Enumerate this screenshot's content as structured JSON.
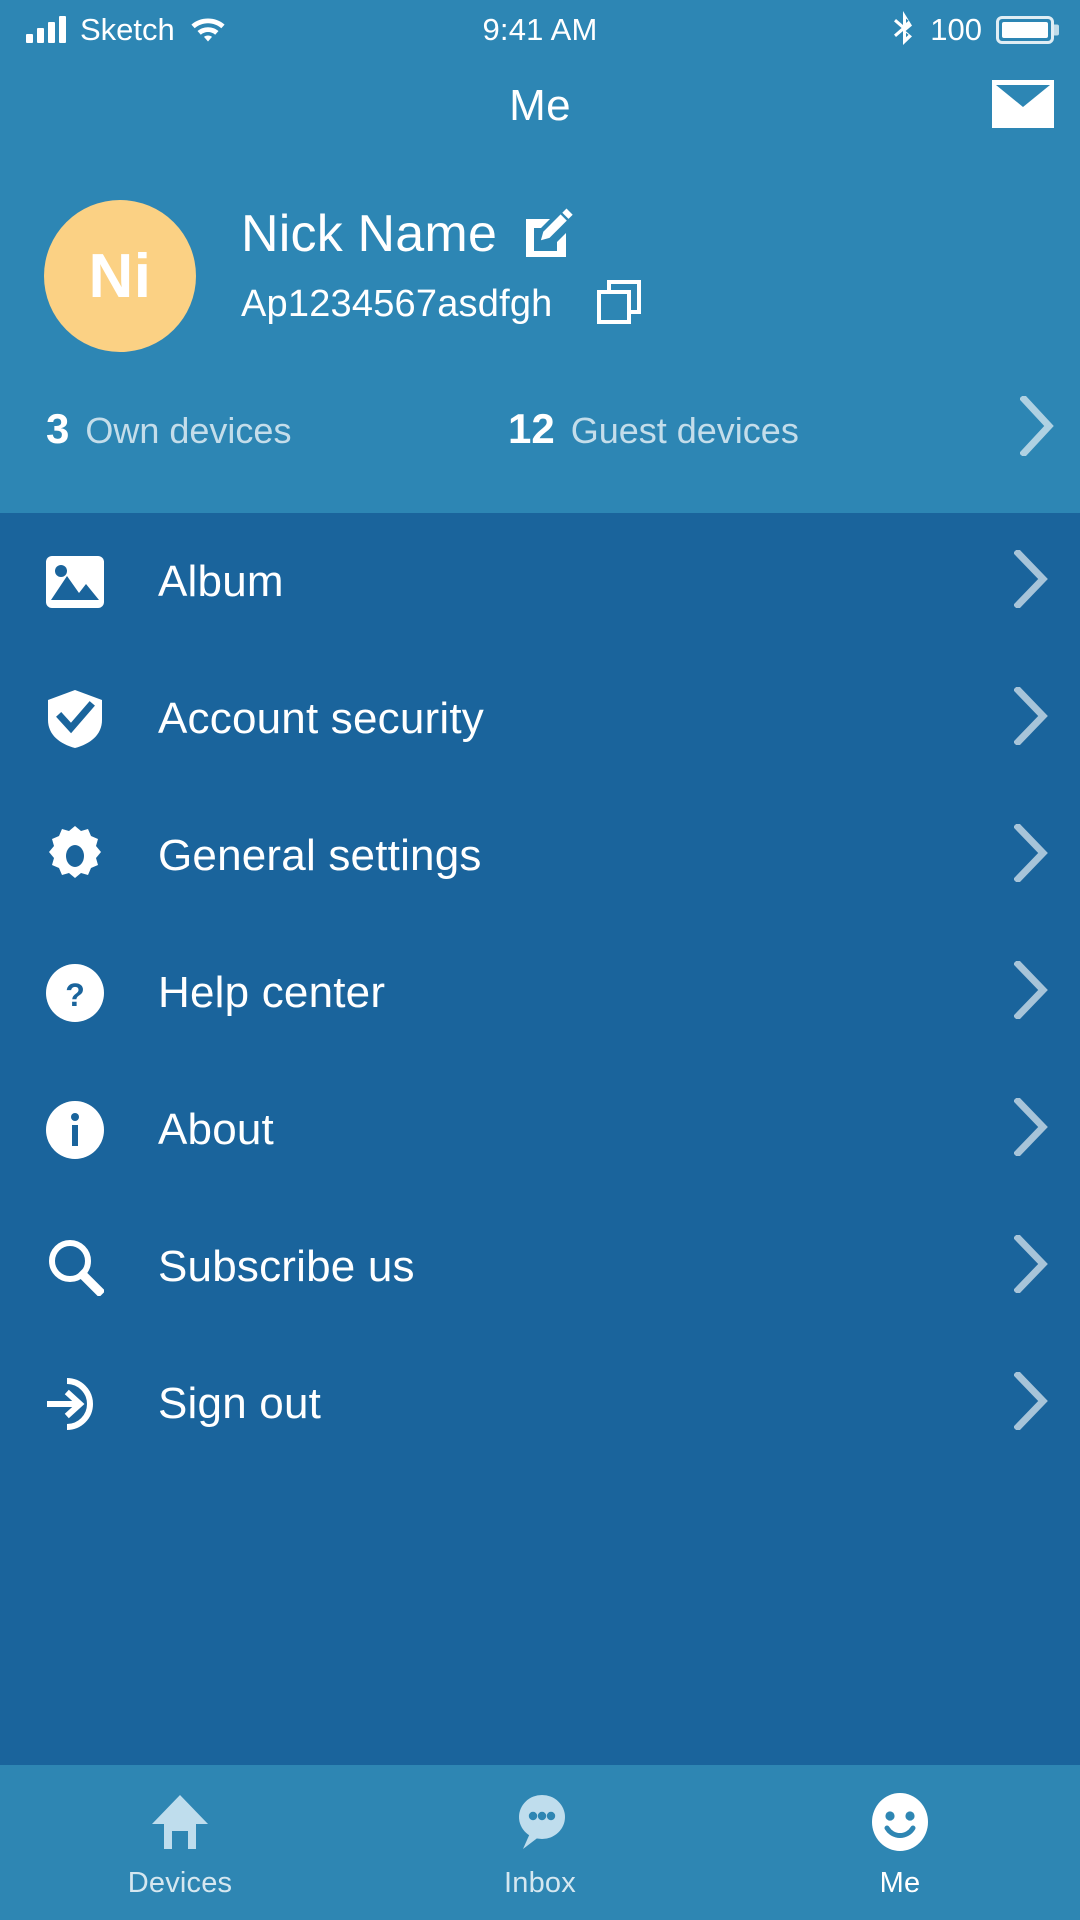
{
  "status_bar": {
    "carrier": "Sketch",
    "time": "9:41 AM",
    "battery_percent": "100",
    "signal_icon": "signal-bars-icon",
    "wifi_icon": "wifi-icon",
    "bluetooth_icon": "bluetooth-icon",
    "battery_icon": "battery-full-icon"
  },
  "nav": {
    "title": "Me",
    "mail_icon": "mail-icon"
  },
  "profile": {
    "avatar_initials": "Ni",
    "avatar_color": "#fbd184",
    "name": "Nick Name",
    "edit_icon": "edit-pencil-icon",
    "account_id": "Ap1234567asdfgh",
    "copy_icon": "copy-icon",
    "own_devices_count": "3",
    "own_devices_label": "Own devices",
    "guest_devices_count": "12",
    "guest_devices_label": "Guest devices",
    "chevron_icon": "chevron-right-icon"
  },
  "menu": {
    "items": [
      {
        "label": "Album",
        "icon": "photo-icon"
      },
      {
        "label": "Account security",
        "icon": "shield-check-icon"
      },
      {
        "label": "General settings",
        "icon": "gear-icon"
      },
      {
        "label": "Help center",
        "icon": "question-circle-icon"
      },
      {
        "label": "About",
        "icon": "info-circle-icon"
      },
      {
        "label": "Subscribe us",
        "icon": "search-icon"
      },
      {
        "label": "Sign out",
        "icon": "sign-out-icon"
      }
    ]
  },
  "tab_bar": {
    "tabs": [
      {
        "label": "Devices",
        "icon": "home-icon",
        "active": false
      },
      {
        "label": "Inbox",
        "icon": "chat-bubble-icon",
        "active": false
      },
      {
        "label": "Me",
        "icon": "smiley-face-icon",
        "active": true
      }
    ]
  },
  "colors": {
    "header_blue": "#2d86b4",
    "list_blue": "#1a649c",
    "tabbar_blue": "#2e86b3",
    "accent_peach": "#fbd184",
    "text_white": "#ffffff"
  }
}
